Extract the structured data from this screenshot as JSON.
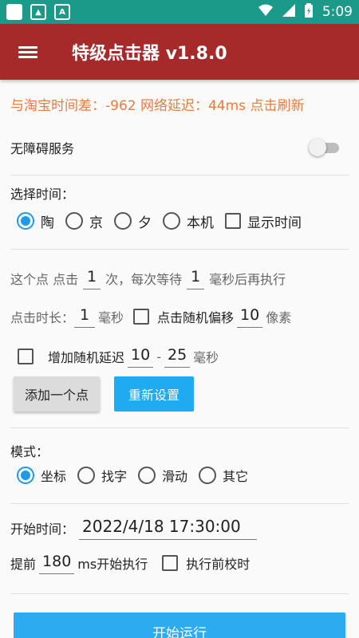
{
  "statusbar": {
    "time": "5:09",
    "app_icon_letter": "A"
  },
  "appbar": {
    "title": "特级点击器 v1.8.0"
  },
  "info": {
    "text": "与淘宝时间差：-962 网络延迟：44ms  点击刷新"
  },
  "accessibility": {
    "label": "无障碍服务",
    "enabled": false
  },
  "time_select": {
    "label": "选择时间：",
    "options": [
      "陶",
      "京",
      "夕",
      "本机"
    ],
    "selected": "陶",
    "show_time_label": "显示时间"
  },
  "click_config": {
    "prefix": "这个点 点击",
    "count": "1",
    "mid": "次，每次等待",
    "wait": "1",
    "suffix": "毫秒后再执行"
  },
  "duration": {
    "label": "点击时长：",
    "value": "1",
    "unit": "毫秒",
    "random_offset_label": "点击随机偏移",
    "offset_value": "10",
    "offset_unit": "像素"
  },
  "random_delay": {
    "label": "增加随机延迟",
    "min": "10",
    "sep": "-",
    "max": "25",
    "unit": "毫秒"
  },
  "buttons": {
    "add_point": "添加一个点",
    "reset": "重新设置",
    "start": "开始运行"
  },
  "mode": {
    "label": "模式：",
    "options": [
      "坐标",
      "找字",
      "滑动",
      "其它"
    ],
    "selected": "坐标"
  },
  "start_time": {
    "label": "开始时间：",
    "value": "2022/4/18 17:30:00"
  },
  "advance": {
    "prefix": "提前",
    "value": "180",
    "suffix": "ms开始执行",
    "calibrate_label": "执行前校时"
  },
  "colors": {
    "status_bar": "#1b9a8a",
    "app_bar": "#a62a2a",
    "accent": "#1e9be8",
    "info_text": "#f07a3a"
  }
}
